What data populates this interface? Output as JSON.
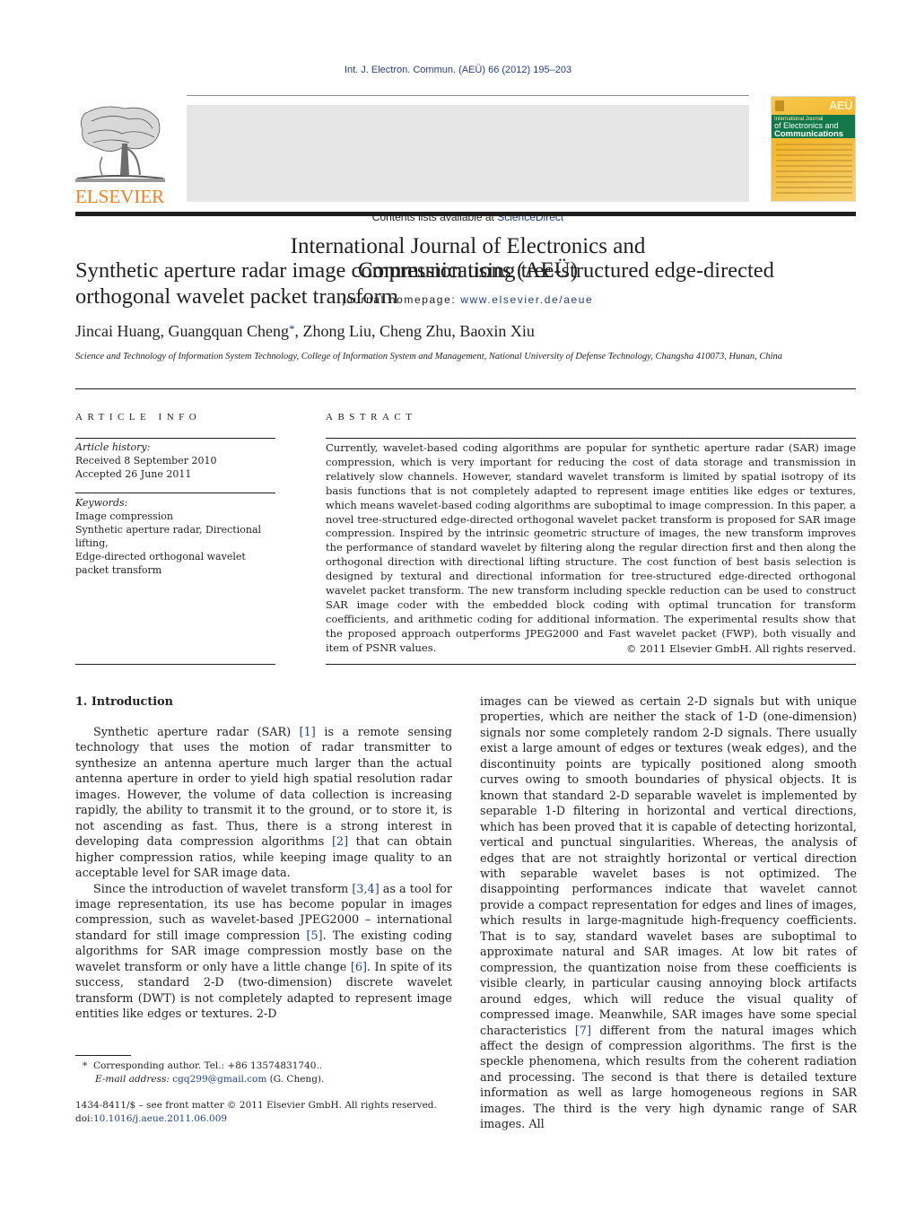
{
  "header": {
    "citation": "Int. J. Electron. Commun. (AEÜ) 66 (2012) 195–203",
    "contents_prefix": "Contents lists available at ",
    "contents_link": "ScienceDirect",
    "journal_title_line1": "International Journal of Electronics and",
    "journal_title_line2": "Communications (AEÜ)",
    "homepage_prefix": "journal homepage: ",
    "homepage_link": "www.elsevier.de/aeue",
    "publisher_logo": "ELSEVIER",
    "cover": {
      "badge": "AEÜ",
      "line1": "International Journal",
      "line2": "of Electronics and",
      "line3": "Communications",
      "colors": {
        "background": "#f3b62c",
        "band": "#12784a"
      }
    }
  },
  "article": {
    "title": "Synthetic aperture radar image compression using tree-structured edge-directed orthogonal wavelet packet transform",
    "authors_before": "Jincai Huang, Guangquan Cheng",
    "corresponding_mark": "*",
    "authors_after": ", Zhong Liu, Cheng Zhu, Baoxin Xiu",
    "affiliation": "Science and Technology of Information System Technology, College of Information System and Management, National University of Defense Technology, Changsha 410073, Hunan, China"
  },
  "article_info": {
    "heading": "ARTICLE INFO",
    "history_label": "Article history:",
    "received": "Received 8 September 2010",
    "accepted": "Accepted 26 June 2011",
    "keywords_label": "Keywords:",
    "keywords": [
      "Image compression",
      "Synthetic aperture radar, Directional lifting,",
      "Edge-directed orthogonal wavelet packet transform"
    ]
  },
  "abstract": {
    "heading": "ABSTRACT",
    "text": "Currently, wavelet-based coding algorithms are popular for synthetic aperture radar (SAR) image compression, which is very important for reducing the cost of data storage and transmission in relatively slow channels. However, standard wavelet transform is limited by spatial isotropy of its basis functions that is not completely adapted to represent image entities like edges or textures, which means wavelet-based coding algorithms are suboptimal to image compression. In this paper, a novel tree-structured edge-directed orthogonal wavelet packet transform is proposed for SAR image compression. Inspired by the intrinsic geometric structure of images, the new transform improves the performance of standard wavelet by filtering along the regular direction first and then along the orthogonal direction with directional lifting structure. The cost function of best basis selection is designed by textural and directional information for tree-structured edge-directed orthogonal wavelet packet transform. The new transform including speckle reduction can be used to construct SAR image coder with the embedded block coding with optimal truncation for transform coefficients, and arithmetic coding for additional information. The experimental results show that the proposed approach outperforms JPEG2000 and Fast wavelet packet (FWP), both visually and item of PSNR values.",
    "copyright": "© 2011 Elsevier GmbH. All rights reserved."
  },
  "body": {
    "section_heading": "1.  Introduction",
    "p1": [
      {
        "t": "Synthetic aperture radar (SAR) "
      },
      {
        "r": "[1]"
      },
      {
        "t": " is a remote sensing technology that uses the motion of radar transmitter to synthesize an antenna aperture much larger than the actual antenna aperture in order to yield high spatial resolution radar images. However, the volume of data collection is increasing rapidly, the ability to transmit it to the ground, or to store it, is not ascending as fast. Thus, there is a strong interest in developing data compression algorithms "
      },
      {
        "r": "[2]"
      },
      {
        "t": " that can obtain higher compression ratios, while keeping image quality to an acceptable level for SAR image data."
      }
    ],
    "p2": [
      {
        "t": "Since the introduction of wavelet transform "
      },
      {
        "r": "[3,4]"
      },
      {
        "t": " as a tool for image representation, its use has become popular in images compression, such as wavelet-based JPEG2000 – international standard for still image compression "
      },
      {
        "r": "[5]"
      },
      {
        "t": ". The existing coding algorithms for SAR image compression mostly base on the wavelet transform or only have a little change "
      },
      {
        "r": "[6]"
      },
      {
        "t": ". In spite of its success, standard 2-D (two-dimension) discrete wavelet transform (DWT) is not completely adapted to represent image entities like edges or textures. 2-D"
      }
    ],
    "p3": [
      {
        "t": "images can be viewed as certain 2-D signals but with unique properties, which are neither the stack of 1-D (one-dimension) signals nor some completely random 2-D signals. There usually exist a large amount of edges or textures (weak edges), and the discontinuity points are typically positioned along smooth curves owing to smooth boundaries of physical objects. It is known that standard 2-D separable wavelet is implemented by separable 1-D filtering in horizontal and vertical directions, which has been proved that it is capable of detecting horizontal, vertical and punctual singularities. Whereas, the analysis of edges that are not straightly horizontal or vertical direction with separable wavelet bases is not optimized. The disappointing performances indicate that wavelet cannot provide a compact representation for edges and lines of images, which results in large-magnitude high-frequency coefficients. That is to say, standard wavelet bases are suboptimal to approximate natural and SAR images. At low bit rates of compression, the quantization noise from these coefficients is visible clearly, in particular causing annoying block artifacts around edges, which will reduce the visual quality of compressed image. Meanwhile, SAR images have some special characteristics "
      },
      {
        "r": "[7]"
      },
      {
        "t": " different from the natural images which affect the design of compression algorithms. The first is the speckle phenomena, which results from the coherent radiation and processing. The second is that there is detailed texture information as well as large homogeneous regions in SAR images. The third is the very high dynamic range of SAR images. All"
      }
    ]
  },
  "footnote": {
    "mark": "*",
    "corresponding": "Corresponding author. Tel.: +86 13574831740..",
    "email_label": "E-mail address:",
    "email": "cgq299@gmail.com",
    "email_suffix": " (G. Cheng)."
  },
  "bottom": {
    "issn_line": "1434-8411/$ – see front matter © 2011 Elsevier GmbH. All rights reserved.",
    "doi_prefix": "doi:",
    "doi": "10.1016/j.aeue.2011.06.009"
  }
}
